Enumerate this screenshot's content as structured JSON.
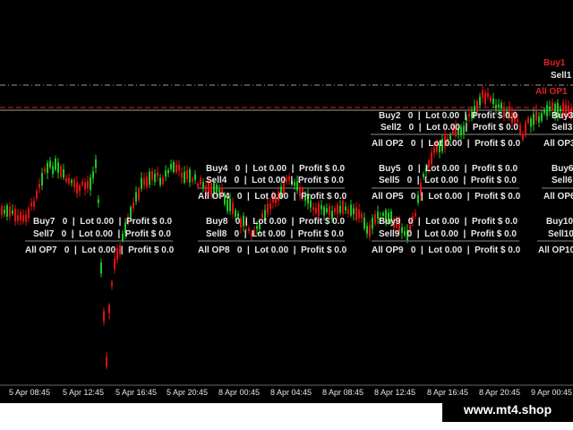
{
  "colors": {
    "background": "#000000",
    "bull_candle": "#1ec81e",
    "bear_candle": "#e01010",
    "text": "#e6e6e6",
    "level_red": "#e02020",
    "level_grey": "#9a9a9a"
  },
  "levels": {
    "buy": "Buy1",
    "sell": "Sell1",
    "all": "All OP1"
  },
  "panels": [
    {
      "buy": "Buy2   0  |  Lot 0.00  |  Profit $ 0.0",
      "sell": "Sell2   0  |  Lot 0.00  |  Profit $ 0.0",
      "all": "All OP2   0  |  Lot 0.00  |  Profit $ 0.0"
    },
    {
      "buy": "Buy3",
      "sell": "Sell3",
      "all": "All OP3"
    },
    {
      "buy": "Buy4   0  |  Lot 0.00  |  Profit $ 0.0",
      "sell": "Sell4   0  |  Lot 0.00  |  Profit $ 0.0",
      "all": "All OP4   0  |  Lot 0.00  |  Profit $ 0.0"
    },
    {
      "buy": "Buy5   0  |  Lot 0.00  |  Profit $ 0.0",
      "sell": "Sell5   0  |  Lot 0.00  |  Profit $ 0.0",
      "all": "All OP5   0  |  Lot 0.00  |  Profit $ 0.0"
    },
    {
      "buy": "Buy6",
      "sell": "Sell6",
      "all": "All OP6"
    },
    {
      "buy": "Buy7   0  |  Lot 0.00  |  Profit $ 0.0",
      "sell": "Sell7   0  |  Lot 0.00  |  Profit $ 0.0",
      "all": "All OP7   0  |  Lot 0.00  |  Profit $ 0.0"
    },
    {
      "buy": "Buy8   0  |  Lot 0.00  |  Profit $ 0.0",
      "sell": "Sell8   0  |  Lot 0.00  |  Profit $ 0.0",
      "all": "All OP8   0  |  Lot 0.00  |  Profit $ 0.0"
    },
    {
      "buy": "Buy9   0  |  Lot 0.00  |  Profit $ 0.0",
      "sell": "Sell9   0  |  Lot 0.00  |  Profit $ 0.0",
      "all": "All OP9   0  |  Lot 0.00  |  Profit $ 0.0"
    },
    {
      "buy": "Buy10",
      "sell": "Sell10",
      "all": "All OP10"
    }
  ],
  "time_axis": [
    "5 Apr 08:45",
    "5 Apr 12:45",
    "5 Apr 16:45",
    "5 Apr 20:45",
    "8 Apr 00:45",
    "8 Apr 04:45",
    "8 Apr 08:45",
    "8 Apr 12:45",
    "8 Apr 16:45",
    "8 Apr 20:45",
    "9 Apr 00:45"
  ],
  "watermark": "www.mt4.shop"
}
